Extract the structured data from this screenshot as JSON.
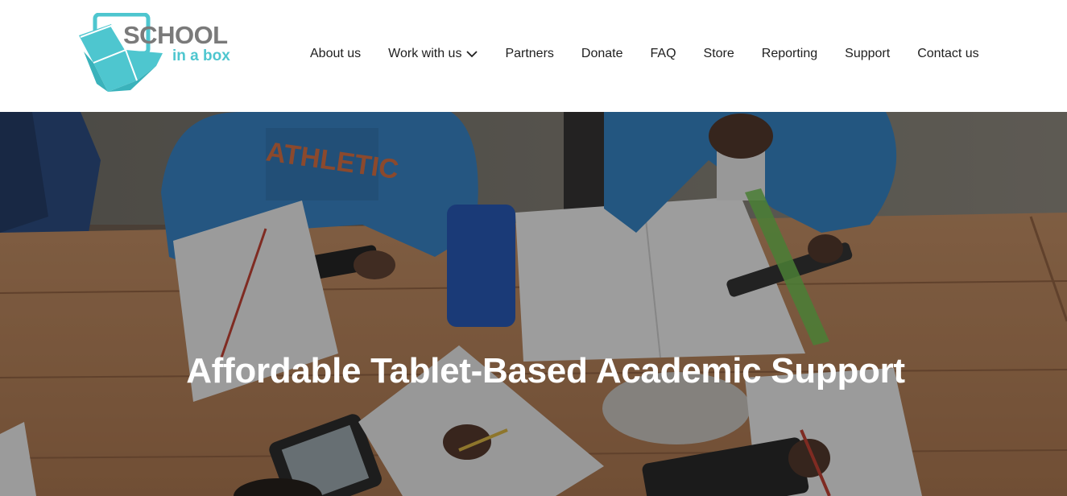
{
  "brand": {
    "logo_line1": "SCHOOL",
    "logo_line2": "in a box",
    "primary_color": "#4ec6cf",
    "secondary_color": "#7a7a7a"
  },
  "nav": {
    "items": [
      {
        "label": "About us"
      },
      {
        "label": "Work with us",
        "icon": "chevron-down-icon"
      },
      {
        "label": "Partners"
      },
      {
        "label": "Donate"
      },
      {
        "label": "FAQ"
      },
      {
        "label": "Store"
      },
      {
        "label": "Reporting"
      },
      {
        "label": "Support"
      },
      {
        "label": "Contact us"
      }
    ]
  },
  "hero": {
    "title": "Affordable Tablet-Based Academic Support",
    "image_subject": "students using tablets at a wooden desk"
  }
}
